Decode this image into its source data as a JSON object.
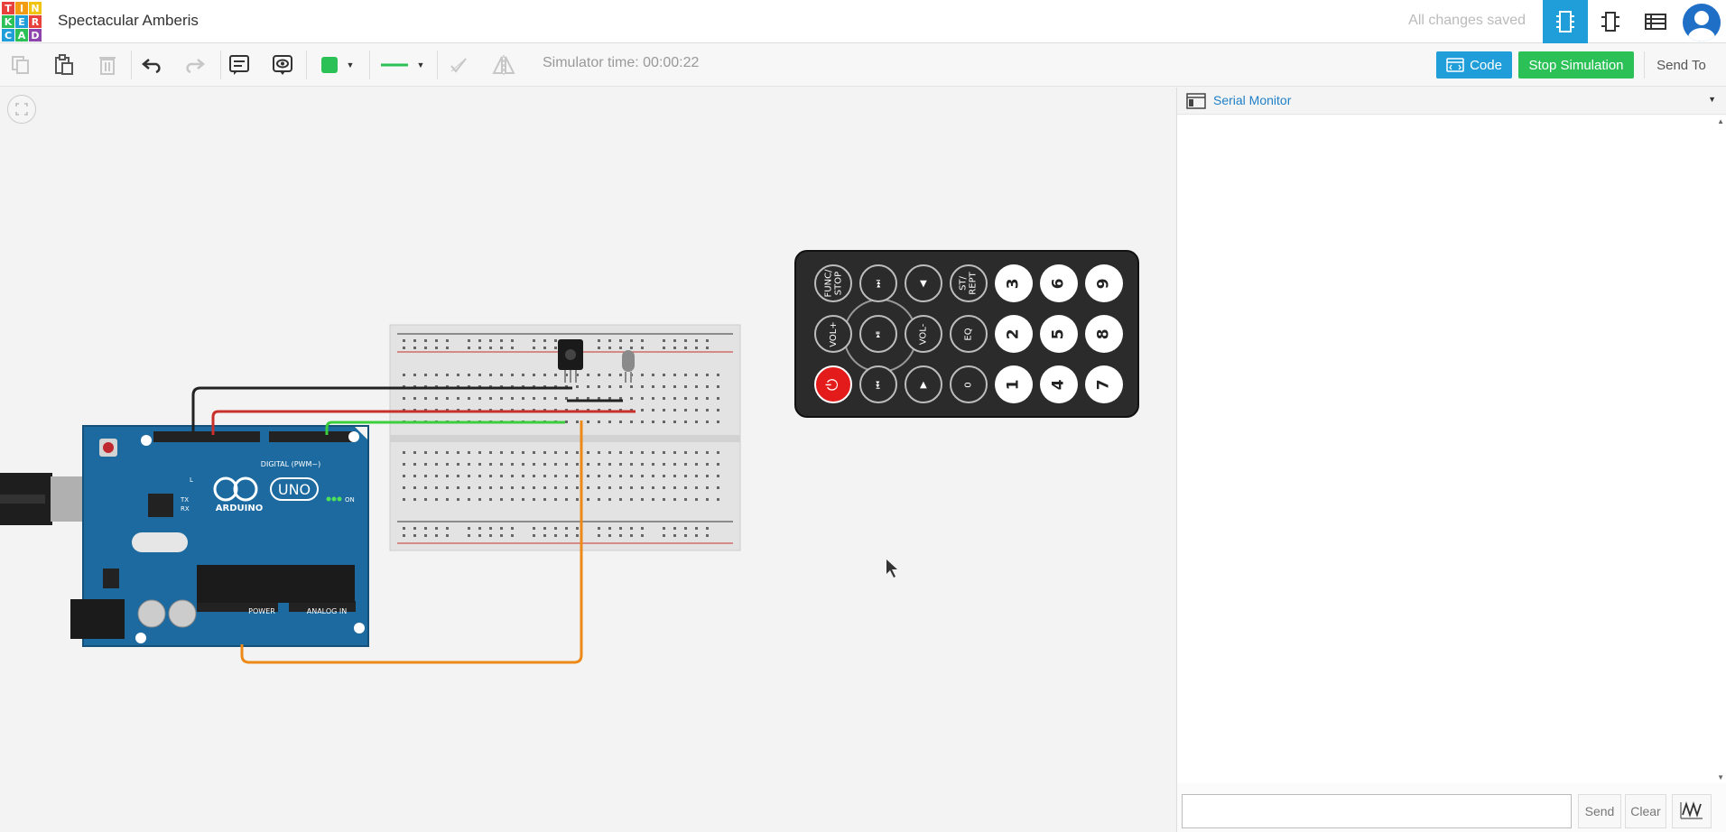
{
  "app": {
    "logo_letters": [
      "T",
      "I",
      "N",
      "K",
      "E",
      "R",
      "C",
      "A",
      "D"
    ],
    "logo_colors": [
      "#e8403b",
      "#f39c12",
      "#f1c40f",
      "#2bc157",
      "#1f9ed9",
      "#e8403b",
      "#1f9ed9",
      "#2bc157",
      "#8e44ad"
    ],
    "title": "Spectacular Amberis",
    "save_status": "All changes saved"
  },
  "toolbar": {
    "sim_time": "Simulator time: 00:00:22",
    "code_label": "Code",
    "stop_label": "Stop Simulation",
    "send_to_label": "Send To",
    "fill_color": "#2bc157",
    "wire_color": "#2bc157"
  },
  "serial_monitor": {
    "title": "Serial Monitor",
    "input_value": "",
    "send_label": "Send",
    "clear_label": "Clear"
  },
  "remote": {
    "buttons": [
      {
        "id": "func-stop",
        "label": "FUNC/\nSTOP",
        "style": "dark"
      },
      {
        "id": "next",
        "label": "⏭",
        "style": "dark"
      },
      {
        "id": "vol-up",
        "label": "VOL+",
        "style": "dark"
      },
      {
        "id": "play-pause",
        "label": "⏯",
        "style": "dark"
      },
      {
        "id": "power",
        "label": "⏻",
        "style": "power"
      },
      {
        "id": "prev",
        "label": "⏮",
        "style": "dark"
      },
      {
        "id": "up",
        "label": "◀",
        "style": "dark"
      },
      {
        "id": "vol-down",
        "label": "VOL-",
        "style": "dark"
      },
      {
        "id": "down",
        "label": "▶",
        "style": "dark"
      },
      {
        "id": "st-rept",
        "label": "ST/\nREPT",
        "style": "dark"
      },
      {
        "id": "eq",
        "label": "EQ",
        "style": "dark"
      },
      {
        "id": "num-0",
        "label": "0",
        "style": "dark"
      },
      {
        "id": "num-3",
        "label": "3",
        "style": "light"
      },
      {
        "id": "num-2",
        "label": "2",
        "style": "light"
      },
      {
        "id": "num-1",
        "label": "1",
        "style": "light"
      },
      {
        "id": "num-6",
        "label": "6",
        "style": "light"
      },
      {
        "id": "num-5",
        "label": "5",
        "style": "light"
      },
      {
        "id": "num-4",
        "label": "4",
        "style": "light"
      },
      {
        "id": "num-9",
        "label": "9",
        "style": "light"
      },
      {
        "id": "num-8",
        "label": "8",
        "style": "light"
      },
      {
        "id": "num-7",
        "label": "7",
        "style": "light"
      }
    ]
  },
  "arduino": {
    "brand": "ARDUINO",
    "model": "UNO",
    "digital_label": "DIGITAL (PWM~)",
    "power_label": "POWER",
    "analog_label": "ANALOG IN",
    "on_label": "ON",
    "tx_label": "TX",
    "rx_label": "RX",
    "l_label": "L"
  }
}
